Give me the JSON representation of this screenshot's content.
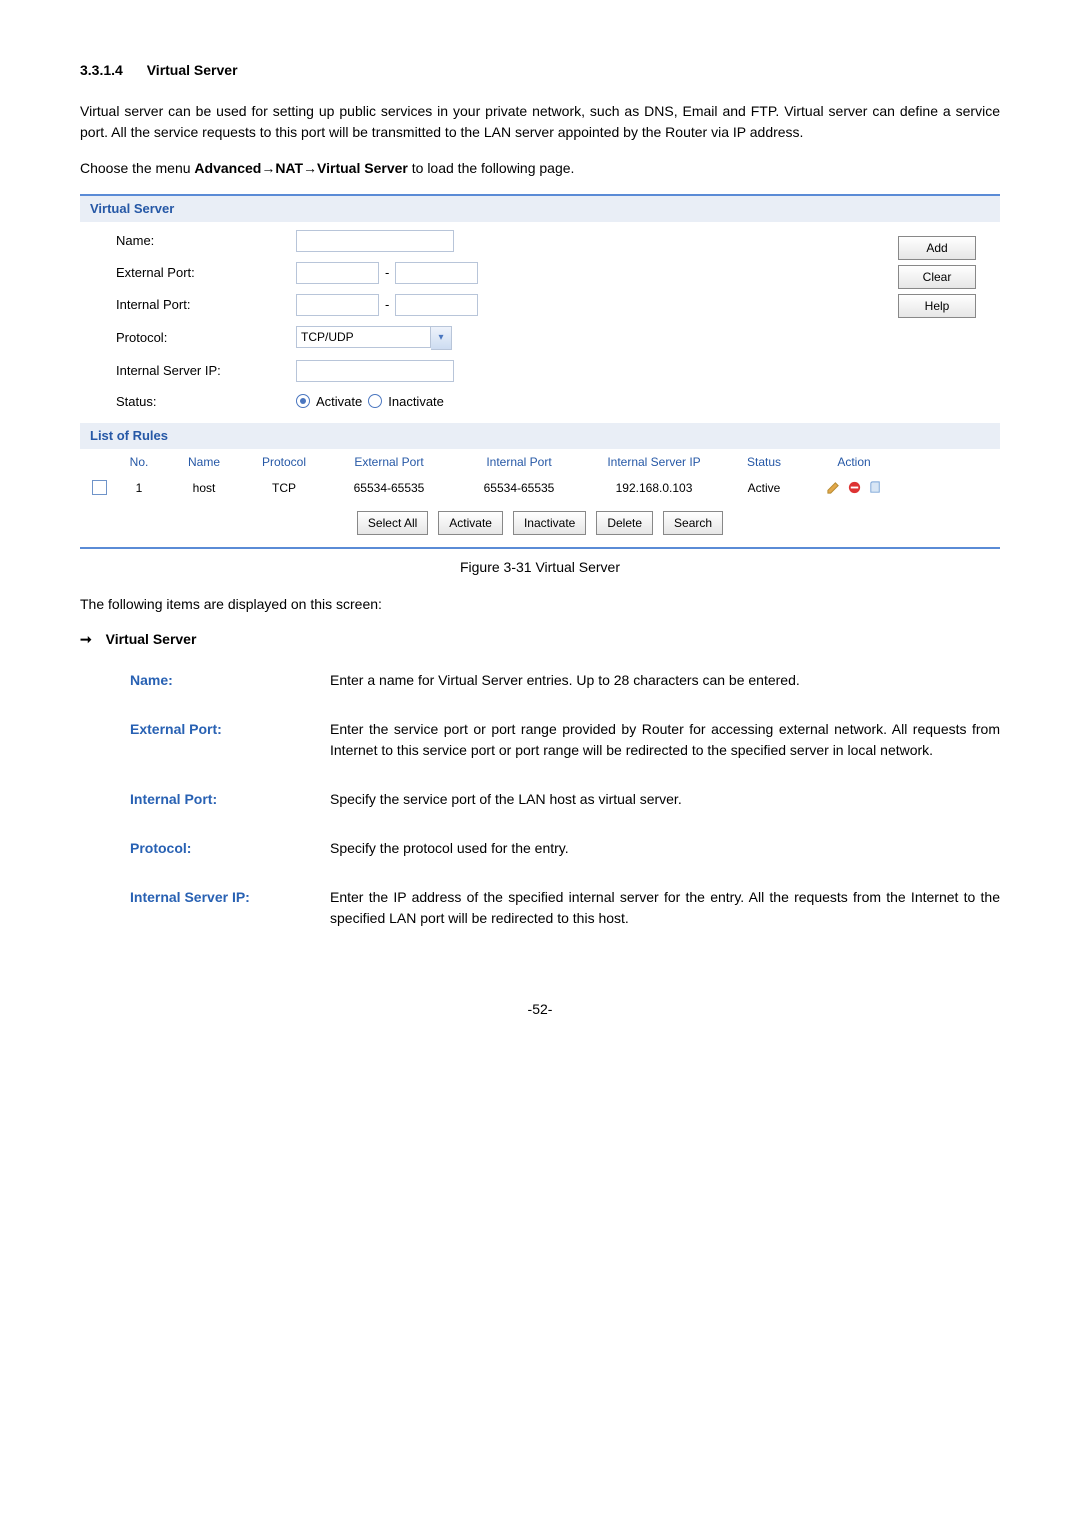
{
  "section": {
    "number": "3.3.1.4",
    "title": "Virtual Server"
  },
  "intro": "Virtual server can be used for setting up public services in your private network, such as DNS, Email and FTP. Virtual server can define a service port. All the service requests to this port will be transmitted to the LAN server appointed by the Router via IP address.",
  "menu_line_pre": "Choose the menu ",
  "menu_line_bold": "Advanced→NAT→Virtual Server",
  "menu_line_post": " to load the following page.",
  "panel": {
    "title": "Virtual Server",
    "fields": {
      "name_label": "Name:",
      "ext_label": "External Port:",
      "int_label": "Internal Port:",
      "proto_label": "Protocol:",
      "proto_value": "TCP/UDP",
      "srvip_label": "Internal Server IP:",
      "status_label": "Status:",
      "activate": "Activate",
      "inactivate": "Inactivate"
    },
    "buttons": {
      "add": "Add",
      "clear": "Clear",
      "help": "Help"
    }
  },
  "rules": {
    "title": "List of Rules",
    "headers": {
      "no": "No.",
      "name": "Name",
      "proto": "Protocol",
      "ext": "External Port",
      "intp": "Internal Port",
      "srvip": "Internal Server IP",
      "status": "Status",
      "action": "Action"
    },
    "row": {
      "no": "1",
      "name": "host",
      "proto": "TCP",
      "ext": "65534-65535",
      "intp": "65534-65535",
      "srvip": "192.168.0.103",
      "status": "Active"
    },
    "toolbar": {
      "selectall": "Select All",
      "activate": "Activate",
      "inactivate": "Inactivate",
      "delete": "Delete",
      "search": "Search"
    }
  },
  "fig_caption": "Figure 3-31 Virtual Server",
  "follow_text": "The following items are displayed on this screen:",
  "bullet_title": "Virtual Server",
  "defs": {
    "name": {
      "term": "Name:",
      "desc": "Enter a name for Virtual Server entries. Up to 28 characters can be entered."
    },
    "ext": {
      "term": "External Port:",
      "desc": "Enter the service port or port range provided by Router for accessing external network. All requests from Internet to this service port or port range will be redirected to the specified server in local network."
    },
    "intp": {
      "term": "Internal Port:",
      "desc": "Specify the service port of the LAN host as virtual server."
    },
    "proto": {
      "term": "Protocol:",
      "desc": "Specify the protocol used for the entry."
    },
    "srvip": {
      "term": "Internal Server IP:",
      "desc": "Enter the IP address of the specified internal server for the entry. All the requests from the Internet to the specified LAN port will be redirected to this host."
    }
  },
  "page_number": "-52-"
}
